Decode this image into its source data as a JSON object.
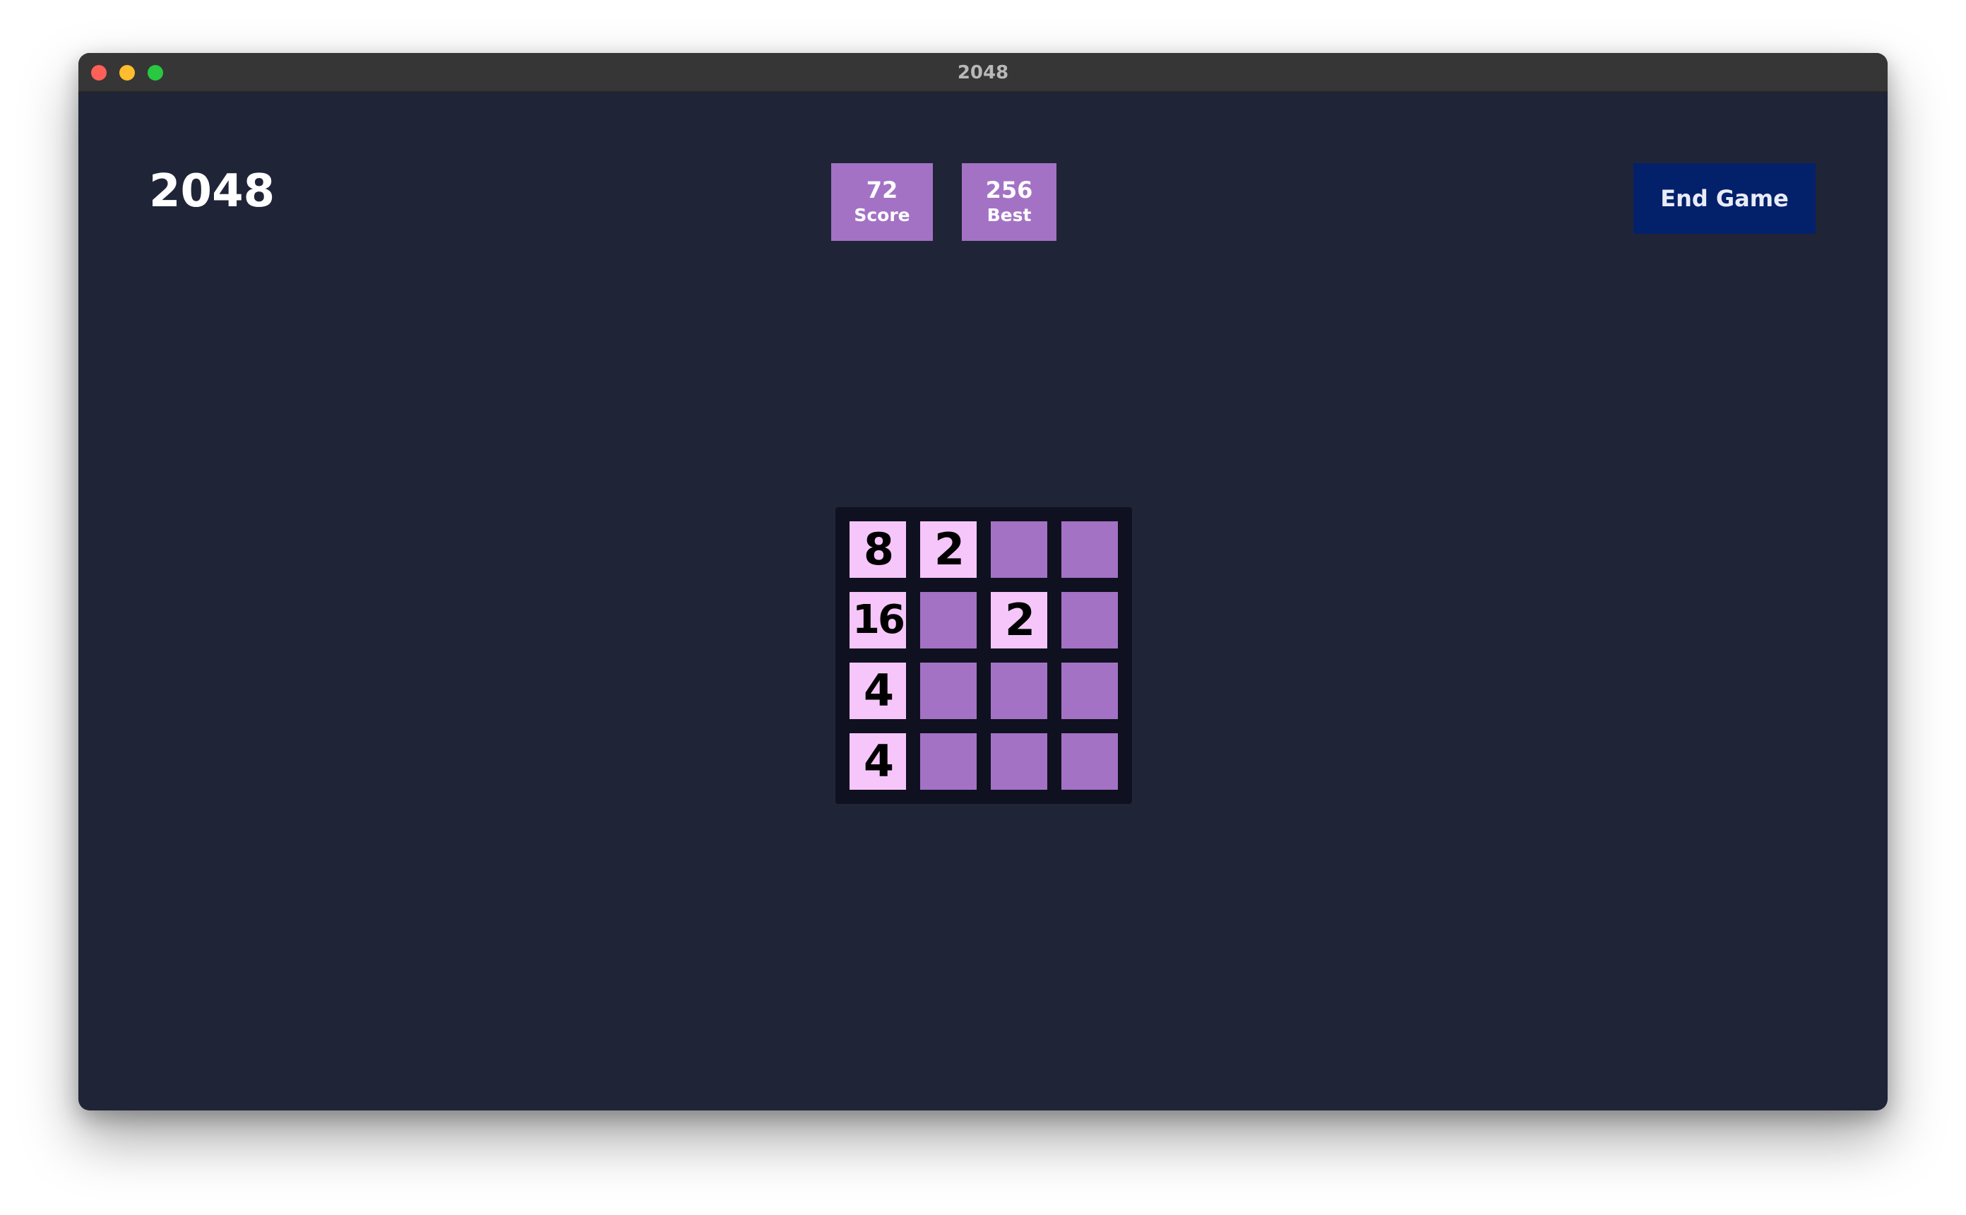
{
  "window": {
    "title": "2048"
  },
  "header": {
    "game_title": "2048",
    "score": {
      "value": "72",
      "label": "Score"
    },
    "best": {
      "value": "256",
      "label": "Best"
    },
    "end_button_label": "End Game"
  },
  "board": {
    "rows": [
      [
        "8",
        "2",
        "",
        ""
      ],
      [
        "16",
        "",
        "2",
        ""
      ],
      [
        "4",
        "",
        "",
        ""
      ],
      [
        "4",
        "",
        "",
        ""
      ]
    ]
  },
  "colors": {
    "background": "#1f2437",
    "board": "#0f1120",
    "empty_tile": "#a372c4",
    "filled_tile": "#f6c6fa",
    "stat_box": "#a372c4",
    "end_button": "#03206b"
  }
}
